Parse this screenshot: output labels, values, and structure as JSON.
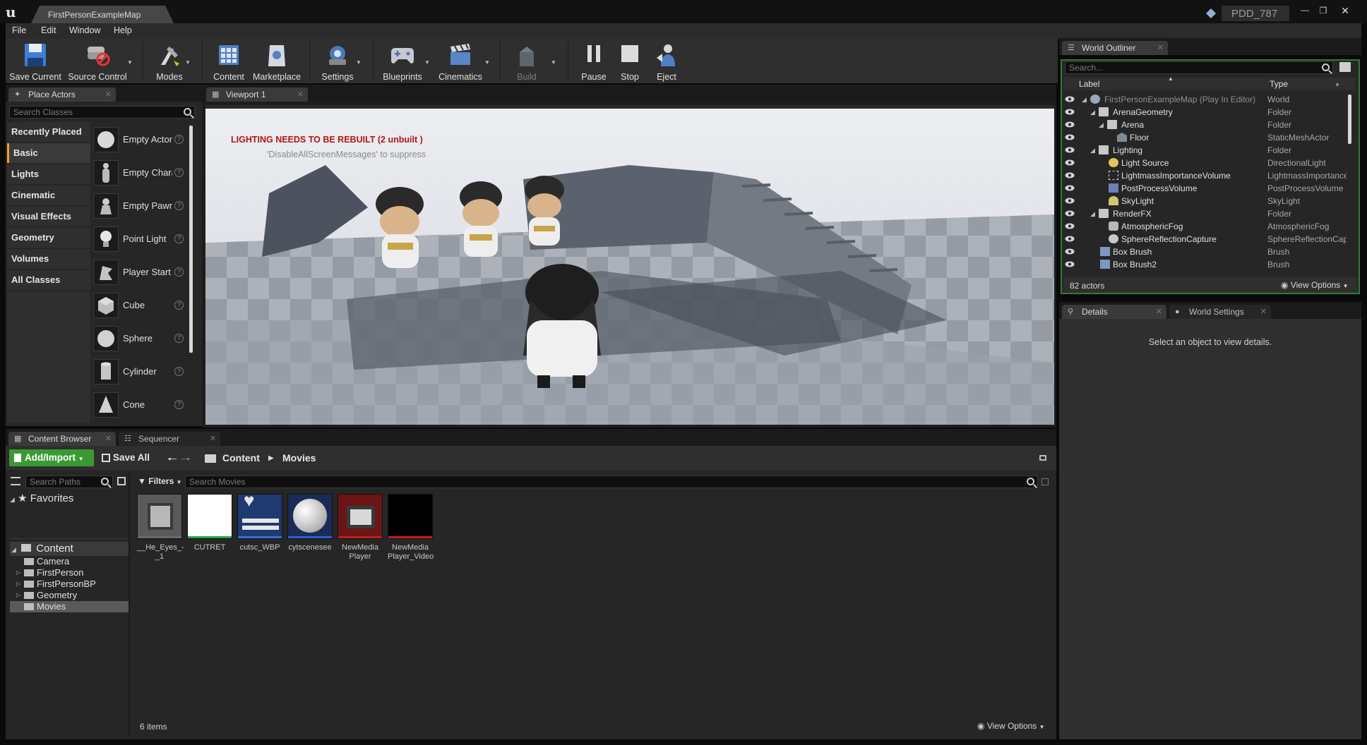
{
  "window": {
    "tab_title": "FirstPersonExampleMap",
    "project_name": "PDD_787"
  },
  "menu": [
    "File",
    "Edit",
    "Window",
    "Help"
  ],
  "toolbar": {
    "save_current": "Save Current",
    "source_control": "Source Control",
    "modes": "Modes",
    "content": "Content",
    "marketplace": "Marketplace",
    "settings": "Settings",
    "blueprints": "Blueprints",
    "cinematics": "Cinematics",
    "build": "Build",
    "pause": "Pause",
    "stop": "Stop",
    "eject": "Eject"
  },
  "place_actors": {
    "tab": "Place Actors",
    "search_placeholder": "Search Classes",
    "categories": [
      "Recently Placed",
      "Basic",
      "Lights",
      "Cinematic",
      "Visual Effects",
      "Geometry",
      "Volumes",
      "All Classes"
    ],
    "selected_category": "Basic",
    "items": [
      "Empty Actor",
      "Empty Character",
      "Empty Pawn",
      "Point Light",
      "Player Start",
      "Cube",
      "Sphere",
      "Cylinder",
      "Cone"
    ]
  },
  "viewport": {
    "tab": "Viewport 1",
    "warning": "LIGHTING NEEDS TO BE REBUILT (2 unbuilt )",
    "hint": "'DisableAllScreenMessages' to suppress"
  },
  "world_outliner": {
    "tab": "World Outliner",
    "search_placeholder": "Search...",
    "col_label": "Label",
    "col_type": "Type",
    "rows": [
      {
        "label": "FirstPersonExampleMap (Play In Editor)",
        "type": "World"
      },
      {
        "label": "ArenaGeometry",
        "type": "Folder"
      },
      {
        "label": "Arena",
        "type": "Folder"
      },
      {
        "label": "Floor",
        "type": "StaticMeshActor"
      },
      {
        "label": "Lighting",
        "type": "Folder"
      },
      {
        "label": "Light Source",
        "type": "DirectionalLight"
      },
      {
        "label": "LightmassImportanceVolume",
        "type": "LightmassImportanceVolume"
      },
      {
        "label": "PostProcessVolume",
        "type": "PostProcessVolume"
      },
      {
        "label": "SkyLight",
        "type": "SkyLight"
      },
      {
        "label": "RenderFX",
        "type": "Folder"
      },
      {
        "label": "AtmosphericFog",
        "type": "AtmosphericFog"
      },
      {
        "label": "SphereReflectionCapture",
        "type": "SphereReflectionCapture"
      },
      {
        "label": "Box Brush",
        "type": "Brush"
      },
      {
        "label": "Box Brush2",
        "type": "Brush"
      }
    ],
    "count": "82 actors",
    "view_options": "View Options"
  },
  "details": {
    "tab": "Details",
    "tab2": "World Settings",
    "empty_message": "Select an object to view details."
  },
  "content_browser": {
    "tab": "Content Browser",
    "tab2": "Sequencer",
    "add_import": "Add/Import",
    "save_all": "Save All",
    "path": [
      "Content",
      "Movies"
    ],
    "search_paths_placeholder": "Search Paths",
    "favorites": "Favorites",
    "tree_root": "Content",
    "folders": [
      "Camera",
      "FirstPerson",
      "FirstPersonBP",
      "Geometry",
      "Movies"
    ],
    "filters": "Filters",
    "search_placeholder": "Search Movies",
    "assets": [
      {
        "name": "__He_Eyes_-_1",
        "color": "#6b6b6b"
      },
      {
        "name": "CUTRET",
        "color": "#2aa34a"
      },
      {
        "name": "cutsc_WBP",
        "color": "#3e6dd6"
      },
      {
        "name": "cytscenesee",
        "color": "#2e5fd8"
      },
      {
        "name": "NewMedia Player",
        "color": "#c41e1e"
      },
      {
        "name": "NewMedia Player_Video",
        "color": "#c41e1e"
      }
    ],
    "item_count": "6 items",
    "view_options": "View Options"
  }
}
